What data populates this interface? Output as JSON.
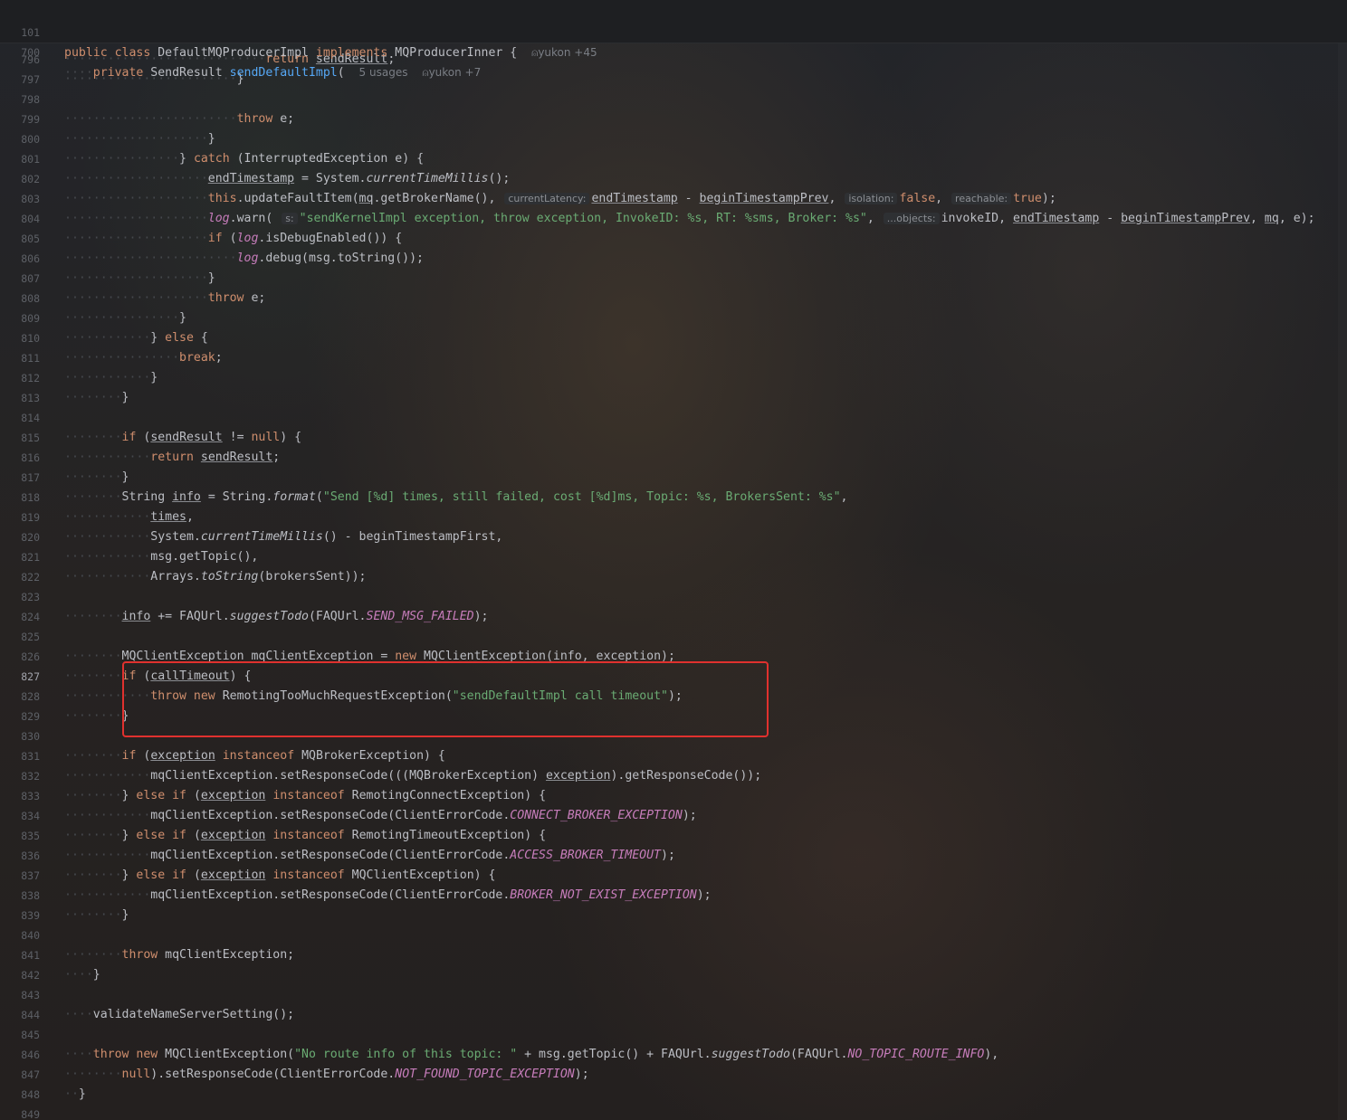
{
  "sticky_header": {
    "line1": {
      "num": "101",
      "text": "public class DefaultMQProducerImpl implements MQProducerInner {",
      "author": "yukon +45"
    },
    "line2": {
      "num": "700",
      "text": "private SendResult sendDefaultImpl(",
      "usages": "5 usages",
      "author": "yukon +7"
    }
  },
  "highlight_box": {
    "color": "#e0312e",
    "from_line": 827,
    "to_line": 829
  },
  "lines": [
    {
      "n": "796",
      "d": 14,
      "h": "<span class=\"kw\">return</span> <span class=\"ul\">sendResult</span>;"
    },
    {
      "n": "797",
      "d": 12,
      "h": "}"
    },
    {
      "n": "798",
      "d": 0,
      "h": ""
    },
    {
      "n": "799",
      "d": 12,
      "h": "<span class=\"kw\">throw</span> e;"
    },
    {
      "n": "800",
      "d": 10,
      "h": "}"
    },
    {
      "n": "801",
      "d": 8,
      "h": "} <span class=\"kw\">catch</span> (InterruptedException e) {"
    },
    {
      "n": "802",
      "d": 10,
      "h": "<span class=\"ul\">endTimestamp</span> = System.<span class=\"it\">currentTimeMillis</span>();"
    },
    {
      "n": "803",
      "d": 10,
      "h": "<span class=\"kw\">this</span>.updateFaultItem(<span class=\"ul\">mq</span>.getBrokerName(), <span class=\"hint\">currentLatency:</span><span class=\"ul\">endTimestamp</span> - <span class=\"ul\">beginTimestampPrev</span>, <span class=\"hint\">isolation:</span><span class=\"kw\">false</span>, <span class=\"hint\">reachable:</span><span class=\"kw\">true</span>);"
    },
    {
      "n": "804",
      "d": 10,
      "h": "<span class=\"fld\">log</span>.warn( <span class=\"hint\">s:</span><span class=\"str\">\"sendKernelImpl exception, throw exception, InvokeID: %s, RT: %sms, Broker: %s\"</span>, <span class=\"hint\">...objects:</span>invokeID, <span class=\"ul\">endTimestamp</span> - <span class=\"ul\">beginTimestampPrev</span>, <span class=\"ul\">mq</span>, e);"
    },
    {
      "n": "805",
      "d": 10,
      "h": "<span class=\"kw\">if</span> (<span class=\"fld\">log</span>.isDebugEnabled()) {"
    },
    {
      "n": "806",
      "d": 12,
      "h": "<span class=\"fld\">log</span>.debug(msg.toString());"
    },
    {
      "n": "807",
      "d": 10,
      "h": "}"
    },
    {
      "n": "808",
      "d": 10,
      "h": "<span class=\"kw\">throw</span> e;"
    },
    {
      "n": "809",
      "d": 8,
      "h": "}"
    },
    {
      "n": "810",
      "d": 6,
      "h": "} <span class=\"kw\">else</span> {"
    },
    {
      "n": "811",
      "d": 8,
      "h": "<span class=\"kw\">break</span>;"
    },
    {
      "n": "812",
      "d": 6,
      "h": "}"
    },
    {
      "n": "813",
      "d": 4,
      "h": "}"
    },
    {
      "n": "814",
      "d": 0,
      "h": ""
    },
    {
      "n": "815",
      "d": 4,
      "h": "<span class=\"kw\">if</span> (<span class=\"ul\">sendResult</span> != <span class=\"kw\">null</span>) {"
    },
    {
      "n": "816",
      "d": 6,
      "h": "<span class=\"kw\">return</span> <span class=\"ul\">sendResult</span>;"
    },
    {
      "n": "817",
      "d": 4,
      "h": "}"
    },
    {
      "n": "818",
      "d": 4,
      "h": "String <span class=\"ul\">info</span> = String.<span class=\"it\">format</span>(<span class=\"str\">\"Send [%d] times, still failed, cost [%d]ms, Topic: %s, BrokersSent: %s\"</span>,"
    },
    {
      "n": "819",
      "d": 6,
      "h": "<span class=\"ul\">times</span>,"
    },
    {
      "n": "820",
      "d": 6,
      "h": "System.<span class=\"it\">currentTimeMillis</span>() - beginTimestampFirst,"
    },
    {
      "n": "821",
      "d": 6,
      "h": "msg.getTopic(),"
    },
    {
      "n": "822",
      "d": 6,
      "h": "Arrays.<span class=\"it\">toString</span>(brokersSent));"
    },
    {
      "n": "823",
      "d": 0,
      "h": ""
    },
    {
      "n": "824",
      "d": 4,
      "h": "<span class=\"ul\">info</span> += FAQUrl.<span class=\"it\">suggestTodo</span>(FAQUrl.<span class=\"fld\">SEND_MSG_FAILED</span>);"
    },
    {
      "n": "825",
      "d": 0,
      "h": ""
    },
    {
      "n": "826",
      "d": 4,
      "h": "MQClientException mqClientException = <span class=\"kw\">new</span> MQClientException(info, exception);"
    },
    {
      "n": "827",
      "d": 4,
      "h": "<span class=\"kw\">if</span> (<span class=\"ul\">callTimeout</span>) {",
      "cur": true
    },
    {
      "n": "828",
      "d": 6,
      "h": "<span class=\"kw\">throw new</span> RemotingTooMuchRequestException(<span class=\"str\">\"sendDefaultImpl call timeout\"</span>);"
    },
    {
      "n": "829",
      "d": 4,
      "h": "}"
    },
    {
      "n": "830",
      "d": 0,
      "h": ""
    },
    {
      "n": "831",
      "d": 4,
      "h": "<span class=\"kw\">if</span> (<span class=\"ul\">exception</span> <span class=\"kw\">instanceof</span> MQBrokerException) {"
    },
    {
      "n": "832",
      "d": 6,
      "h": "mqClientException.setResponseCode(((MQBrokerException) <span class=\"ul\">exception</span>).getResponseCode());"
    },
    {
      "n": "833",
      "d": 4,
      "h": "} <span class=\"kw\">else if</span> (<span class=\"ul\">exception</span> <span class=\"kw\">instanceof</span> RemotingConnectException) {"
    },
    {
      "n": "834",
      "d": 6,
      "h": "mqClientException.setResponseCode(ClientErrorCode.<span class=\"fld\">CONNECT_BROKER_EXCEPTION</span>);"
    },
    {
      "n": "835",
      "d": 4,
      "h": "} <span class=\"kw\">else if</span> (<span class=\"ul\">exception</span> <span class=\"kw\">instanceof</span> RemotingTimeoutException) {"
    },
    {
      "n": "836",
      "d": 6,
      "h": "mqClientException.setResponseCode(ClientErrorCode.<span class=\"fld\">ACCESS_BROKER_TIMEOUT</span>);"
    },
    {
      "n": "837",
      "d": 4,
      "h": "} <span class=\"kw\">else if</span> (<span class=\"ul\">exception</span> <span class=\"kw\">instanceof</span> MQClientException) {"
    },
    {
      "n": "838",
      "d": 6,
      "h": "mqClientException.setResponseCode(ClientErrorCode.<span class=\"fld\">BROKER_NOT_EXIST_EXCEPTION</span>);"
    },
    {
      "n": "839",
      "d": 4,
      "h": "}"
    },
    {
      "n": "840",
      "d": 0,
      "h": ""
    },
    {
      "n": "841",
      "d": 4,
      "h": "<span class=\"kw\">throw</span> mqClientException;"
    },
    {
      "n": "842",
      "d": 2,
      "h": "}"
    },
    {
      "n": "843",
      "d": 0,
      "h": ""
    },
    {
      "n": "844",
      "d": 2,
      "h": "validateNameServerSetting();"
    },
    {
      "n": "845",
      "d": 0,
      "h": ""
    },
    {
      "n": "846",
      "d": 2,
      "h": "<span class=\"kw\">throw new</span> MQClientException(<span class=\"str\">\"No route info of this topic: \"</span> + msg.getTopic() + FAQUrl.<span class=\"it\">suggestTodo</span>(FAQUrl.<span class=\"fld\">NO_TOPIC_ROUTE_INFO</span>),"
    },
    {
      "n": "847",
      "d": 4,
      "h": "<span class=\"kw\">null</span>).setResponseCode(ClientErrorCode.<span class=\"fld\">NOT_FOUND_TOPIC_EXCEPTION</span>);"
    },
    {
      "n": "848",
      "d": 1,
      "h": "}"
    },
    {
      "n": "849",
      "d": 0,
      "h": ""
    }
  ]
}
